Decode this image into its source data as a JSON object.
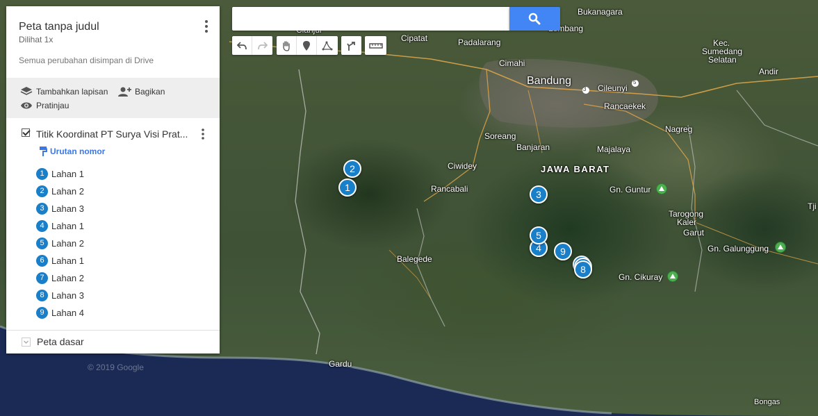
{
  "panel": {
    "title": "Peta tanpa judul",
    "views": "Dilihat 1x",
    "saved_status": "Semua perubahan disimpan di Drive",
    "actions": {
      "add_layer": "Tambahkan lapisan",
      "share": "Bagikan",
      "preview": "Pratinjau"
    },
    "layer": {
      "name": "Titik Koordinat PT Surya Visi Prat...",
      "checked": true,
      "style_label": "Urutan nomor",
      "items": [
        {
          "num": "1",
          "label": "Lahan 1"
        },
        {
          "num": "2",
          "label": "Lahan 2"
        },
        {
          "num": "3",
          "label": "Lahan 3"
        },
        {
          "num": "4",
          "label": "Lahan 1"
        },
        {
          "num": "5",
          "label": "Lahan 2"
        },
        {
          "num": "6",
          "label": "Lahan 1"
        },
        {
          "num": "7",
          "label": "Lahan 2"
        },
        {
          "num": "8",
          "label": "Lahan 3"
        },
        {
          "num": "9",
          "label": "Lahan 4"
        }
      ]
    },
    "basemap_label": "Peta dasar"
  },
  "search": {
    "value": "",
    "placeholder": ""
  },
  "toolbar": {
    "icons": [
      "undo-icon",
      "redo-icon",
      "hand-icon",
      "marker-icon",
      "draw-line-icon",
      "directions-icon",
      "ruler-icon"
    ]
  },
  "map": {
    "copyright": "© 2019 Google",
    "labels": {
      "bukanagara": "Bukanagara",
      "lembang": "Lembang",
      "cipatat": "Cipatat",
      "padalarang": "Padalarang",
      "cimahi": "Cimahi",
      "bandung": "Bandung",
      "cileunyi": "Cileunyi",
      "rancaekek": "Rancaekek",
      "kec_sumedang": "Kec.",
      "sumedang": "Sumedang",
      "selatan": "Selatan",
      "andir": "Andir",
      "nagreg": "Nagreg",
      "soreang": "Soreang",
      "banjaran": "Banjaran",
      "majalaya": "Majalaya",
      "ciwidey": "Ciwidey",
      "jawa_barat": "JAWA BARAT",
      "rancabali": "Rancabali",
      "gn_guntur": "Gn. Guntur",
      "tarogong": "Tarogong",
      "kaler": "Kaler",
      "garut": "Garut",
      "gn_galunggung": "Gn. Galunggung",
      "balegede": "Balegede",
      "gn_cikuray": "Gn. Cikuray",
      "gardu": "Gardu",
      "bongas": "Bongas",
      "tji": "Tji",
      "cianjur": "Cianjur",
      "route_3": "3",
      "route_5": "5"
    },
    "marker_color": "#1a7fc9",
    "markers": [
      {
        "num": "1"
      },
      {
        "num": "2"
      },
      {
        "num": "3"
      },
      {
        "num": "4"
      },
      {
        "num": "5"
      },
      {
        "num": "6"
      },
      {
        "num": "7"
      },
      {
        "num": "8"
      },
      {
        "num": "9"
      }
    ]
  },
  "colors": {
    "accent": "#4285f4",
    "marker": "#1a7fc9",
    "style_link": "#3b78e7"
  }
}
